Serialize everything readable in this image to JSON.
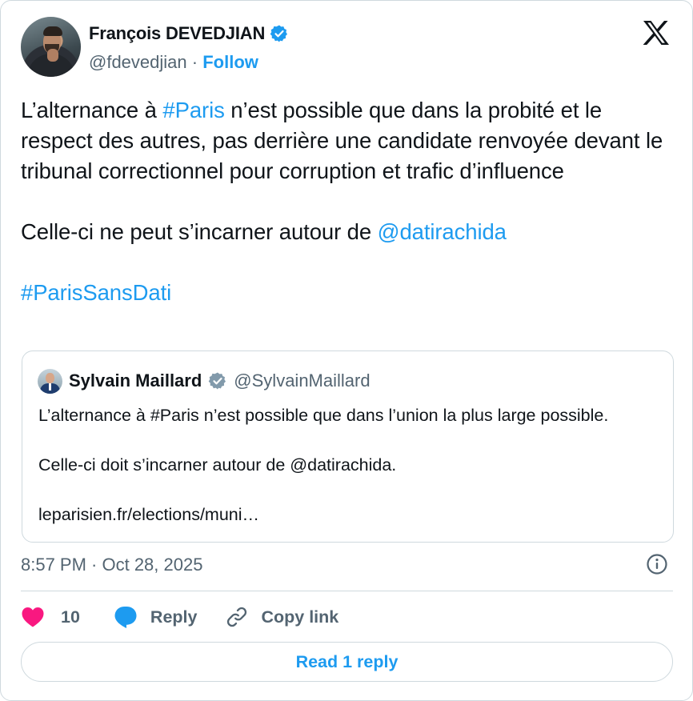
{
  "tweet": {
    "author_name": "François DEVEDJIAN",
    "handle": "@fdevedjian",
    "separator": "·",
    "follow_label": "Follow",
    "text": {
      "line1_pre": "L’alternance à ",
      "line1_hashtag": "#Paris",
      "line1_post": " n’est possible que dans la probité et le respect des autres, pas derrière une candidate renvoyée devant le tribunal correctionnel pour corruption et trafic d’influence",
      "line2_pre": "Celle-ci ne peut s’incarner autour de ",
      "line2_mention": "@datirachida",
      "line3_hashtag": "#ParisSansDati"
    },
    "timestamp": "8:57 PM · Oct 28, 2025",
    "like_count": "10",
    "reply_label": "Reply",
    "copy_link_label": "Copy link",
    "read_replies_label": "Read 1 reply"
  },
  "quote": {
    "author_name": "Sylvain Maillard",
    "handle": "@SylvainMaillard",
    "line1": "L’alternance à #Paris n’est possible que dans l’union la plus large possible.",
    "line2": "Celle-ci doit s’incarner autour de @datirachida.",
    "line3": "leparisien.fr/elections/muni…"
  },
  "icons": {
    "logo": "x-logo-icon",
    "verified": "verified-badge-icon",
    "like": "heart-icon",
    "reply": "speech-bubble-icon",
    "copy_link": "link-icon",
    "info": "info-icon"
  },
  "colors": {
    "accent": "#1d9bf0",
    "like": "#f91880",
    "text_primary": "#0f1419",
    "text_secondary": "#536471",
    "border": "#cfd9de"
  }
}
